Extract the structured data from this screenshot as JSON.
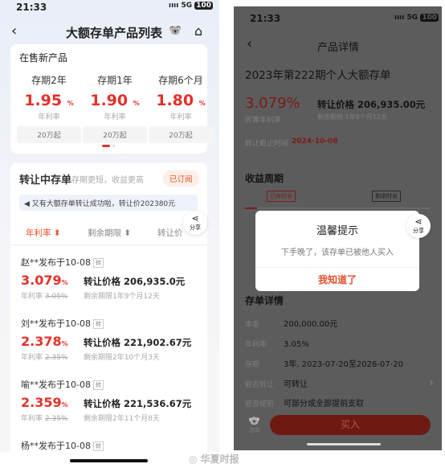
{
  "left": {
    "status": {
      "time": "21:33",
      "network": "5G",
      "battery": "100"
    },
    "nav": {
      "title": "大额存单产品列表",
      "back_icon": "chevron-left-icon",
      "mascot_icon": "mascot-icon",
      "home_icon": "home-icon"
    },
    "new_products": {
      "title": "在售新产品",
      "items": [
        {
          "term": "存期2年",
          "rate": "1.95",
          "unit": "%",
          "rate_label": "年利率",
          "min": "20万起"
        },
        {
          "term": "存期1年",
          "rate": "1.90",
          "unit": "%",
          "rate_label": "年利率",
          "min": "20万起"
        },
        {
          "term": "存期6个月",
          "rate": "1.80",
          "unit": "%",
          "rate_label": "年利率",
          "min": "20万起"
        }
      ]
    },
    "transfer": {
      "title": "转让中存单",
      "subtitle": "存期更短，收益更高",
      "subscribed": "已订阅",
      "notice": "又有大额存单转让成功啦，转让价202380元",
      "sort": [
        "年利率",
        "剩余期限",
        "转让价"
      ],
      "share": "分享",
      "items": [
        {
          "header": "赵**发布于10-08",
          "tag": "转",
          "rate": "3.079",
          "unit": "%",
          "price": "转让价格 206,935.0元",
          "rate_label": "年利率",
          "orig_rate": "3.05%",
          "remaining": "剩余期限1年9个月12天"
        },
        {
          "header": "刘**发布于10-08",
          "tag": "转",
          "rate": "2.378",
          "unit": "%",
          "price": "转让价格 221,902.67元",
          "rate_label": "年利率",
          "orig_rate": "2.35%",
          "remaining": "剩余期限2年10个月3天"
        },
        {
          "header": "喻**发布于10-08",
          "tag": "转",
          "rate": "2.359",
          "unit": "%",
          "price": "转让价格 221,536.67元",
          "rate_label": "年利率",
          "orig_rate": "2.35%",
          "remaining": "剩余期限2年11个月8天"
        },
        {
          "header": "杨**发布于10-08",
          "tag": "转"
        }
      ]
    }
  },
  "right": {
    "status": {
      "time": "21:33",
      "network": "5G",
      "battery": "100"
    },
    "nav": {
      "title": "产品详情"
    },
    "product_title": "2023年第222期个人大额存单",
    "rate": "3.079%",
    "rate_label": "折算年利率",
    "price": "转让价格 206,935.00元",
    "remaining": "剩余期限 1年9个月12天",
    "deadline_label": "转让截止时间",
    "deadline": "2024-10-08",
    "cycle_title": "收益周期",
    "held": "已存时长",
    "left": "剩余时长",
    "details_title": "存单详情",
    "details": [
      {
        "label": "本金",
        "value": "200,000.00元"
      },
      {
        "label": "年利率",
        "value": "3.05%"
      },
      {
        "label": "存期",
        "value": "3年, 2023-07-20至2026-07-20"
      },
      {
        "label": "能否转让",
        "value": "可转让"
      },
      {
        "label": "能否提前",
        "value": "可部分或全部提前支取"
      }
    ],
    "buy": "买入",
    "advisor": "咨询",
    "share": "分享",
    "dialog": {
      "title": "温馨提示",
      "message": "下手晚了，该存单已被他人买入",
      "confirm": "我知道了"
    }
  },
  "watermark": "华夏时报",
  "colors": {
    "accent": "#e4302b",
    "overlay": "#555555"
  }
}
